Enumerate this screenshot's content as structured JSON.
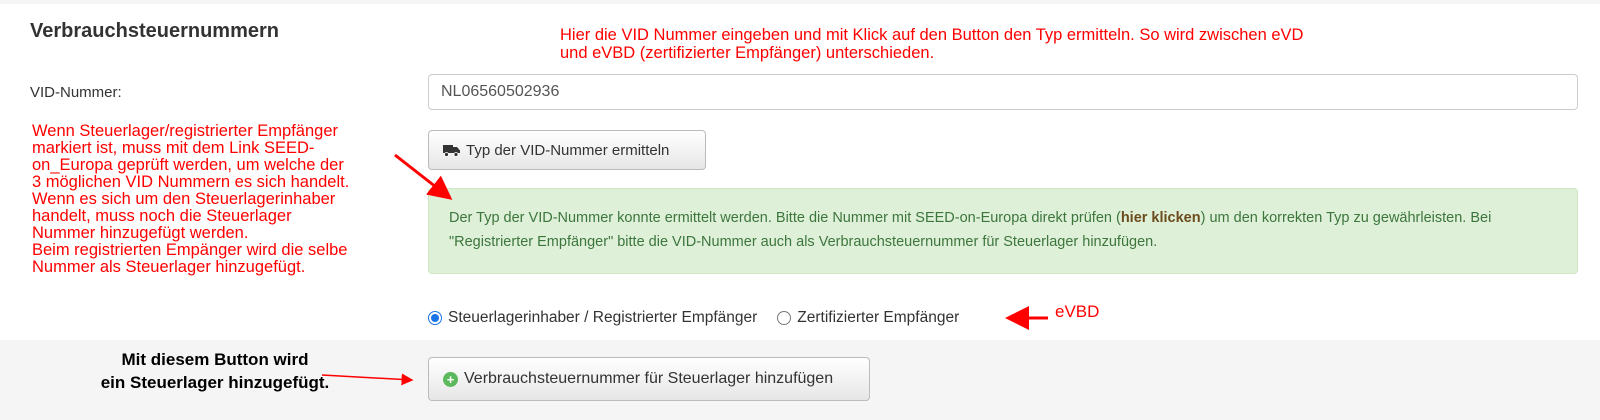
{
  "section": {
    "title": "Verbrauchsteuernummern"
  },
  "annotations": {
    "top": "Hier die VID Nummer eingeben und mit Klick auf den Button den Typ ermitteln. So wird zwischen eVD\nund eVBD (zertifizierter Empfänger) unterschieden.",
    "left": "Wenn Steuerlager/registrierter Empfänger\nmarkiert ist, muss mit dem Link SEED-\non_Europa geprüft werden, um welche der\n3 möglichen VID Nummern es sich handelt.\nWenn es sich um den Steuerlagerinhaber\nhandelt, muss noch die Steuerlager\nNummer hinzugefügt werden.\nBeim registrierten Empänger wird die selbe\nNummer als Steuerlager hinzugefügt.",
    "evbd": "eVBD",
    "bottom": "Mit diesem Button wird\nein Steuerlager hinzugefügt."
  },
  "form": {
    "vid_label": "VID-Nummer:",
    "vid_value": "NL06560502936",
    "type_button_label": "Typ der VID-Nummer ermitteln"
  },
  "alert": {
    "text_before": "Der Typ der VID-Nummer konnte ermittelt werden. Bitte die Nummer mit SEED-on-Europa direkt prüfen (",
    "link_label": "hier klicken",
    "text_after": ") um den korrekten Typ zu gewährleisten. Bei \"Registrierter Empfänger\" bitte die VID-Nummer auch als Verbrauchsteuernummer für Steuerlager hinzufügen."
  },
  "radios": [
    {
      "label": "Steuerlagerinhaber / Registrierter Empfänger",
      "selected": true
    },
    {
      "label": "Zertifizierter Empfänger",
      "selected": false
    }
  ],
  "add_button": {
    "label": "Verbrauchsteuernummer für Steuerlager hinzufügen"
  },
  "icons": {
    "type_button": "truck-icon",
    "add_button": "plus-circle-icon"
  },
  "colors": {
    "annotation": "#ff0000",
    "accent": "#1a73e8",
    "alert_bg": "#dff0d8",
    "alert_text": "#3c763d"
  }
}
